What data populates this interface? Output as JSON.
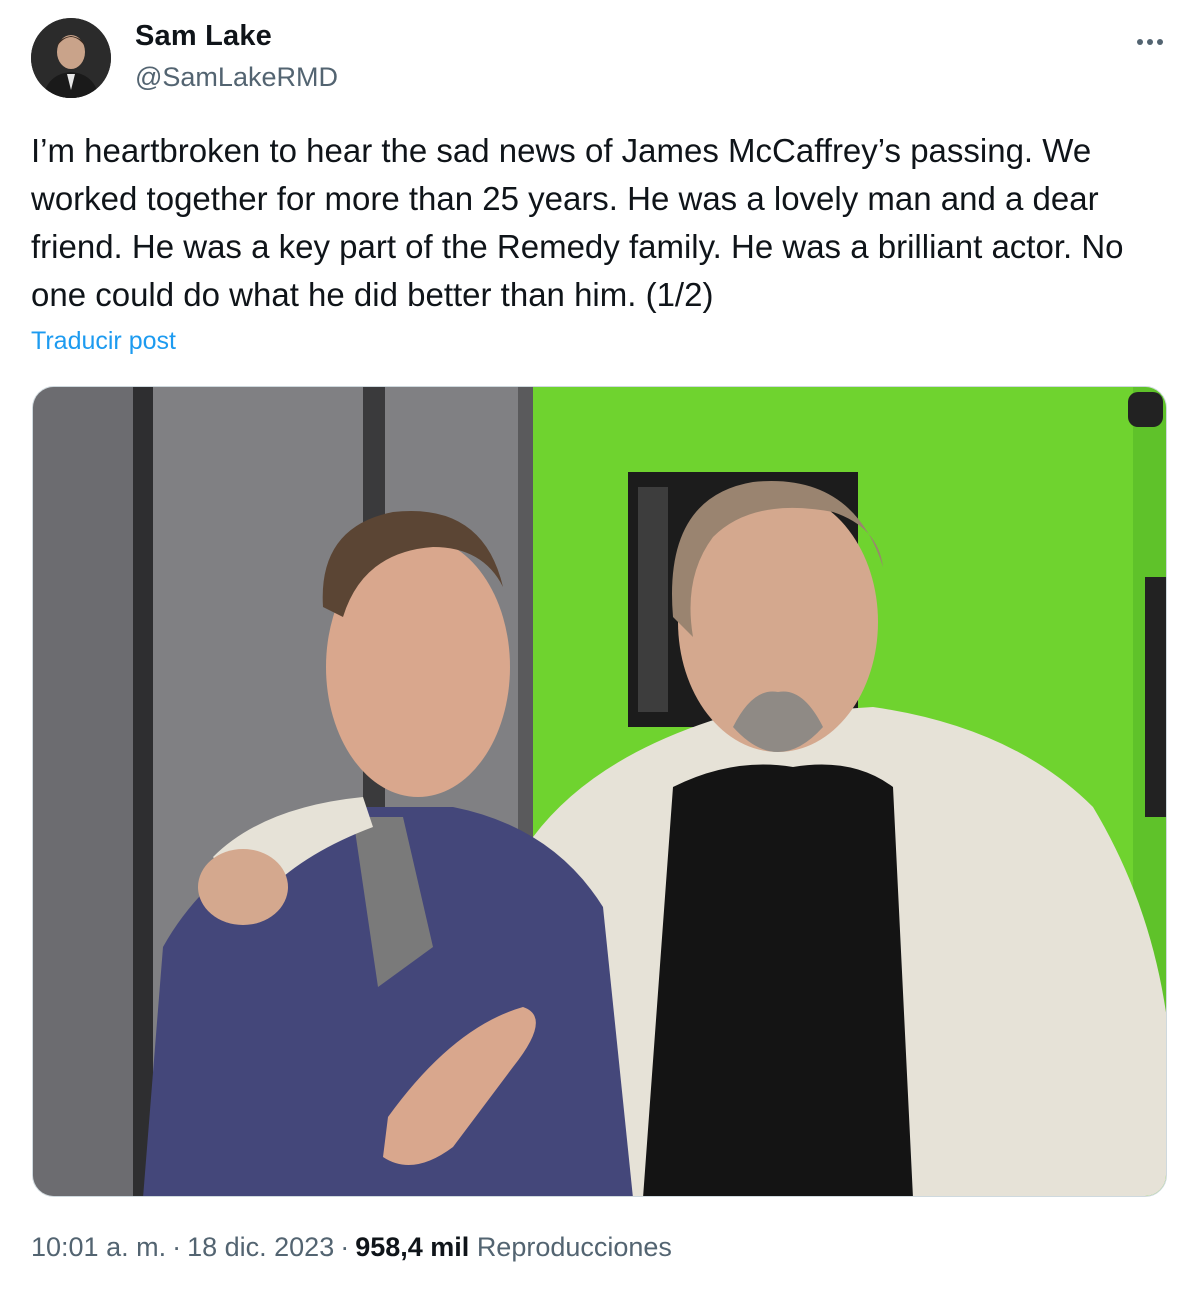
{
  "author": {
    "display_name": "Sam Lake",
    "handle": "@SamLakeRMD",
    "avatar": "profile-avatar"
  },
  "menu": {
    "icon": "more-horizontal-icon"
  },
  "post": {
    "text": "I’m heartbroken to hear the sad news of James McCaffrey’s passing. We worked together for more than 25 years. He was a lovely man and a dear friend. He was a key part of the Remedy family. He was a brilliant actor. No one could do what he did better than him. (1/2)",
    "translate_label": "Traducir post"
  },
  "media": {
    "type": "photo",
    "colors": {
      "green_screen": "#6fd32f",
      "wall": "#7d7d80"
    }
  },
  "footer": {
    "time": "10:01 a. m.",
    "separator": "·",
    "date": "18 dic. 2023",
    "views_count": "958,4 mil",
    "views_label": "Reproducciones"
  },
  "colors": {
    "text": "#0f1419",
    "secondary": "#536471",
    "link": "#1d9bf0"
  }
}
